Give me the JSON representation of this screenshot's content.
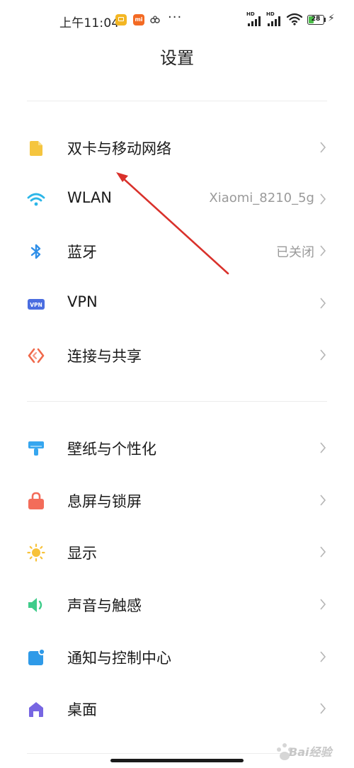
{
  "status_bar": {
    "time": "上午11:04",
    "battery": "28",
    "icons": [
      "note-icon",
      "mi-icon",
      "link-icon",
      "more-icon",
      "signal-icon",
      "signal-icon",
      "wifi-icon",
      "battery-icon",
      "charging-icon"
    ]
  },
  "header": {
    "title": "设置"
  },
  "sections": [
    {
      "items": [
        {
          "label": "双卡与移动网络",
          "value": "",
          "icon": "sim-card-icon",
          "color": "#f5c53f"
        },
        {
          "label": "WLAN",
          "value": "Xiaomi_8210_5g",
          "icon": "wifi-icon",
          "color": "#2cb6e8"
        },
        {
          "label": "蓝牙",
          "value": "已关闭",
          "icon": "bluetooth-icon",
          "color": "#2f8fe8"
        },
        {
          "label": "VPN",
          "value": "",
          "icon": "vpn-icon",
          "color": "#4a6de0"
        },
        {
          "label": "连接与共享",
          "value": "",
          "icon": "connection-share-icon",
          "color": "#f0694b"
        }
      ]
    },
    {
      "items": [
        {
          "label": "壁纸与个性化",
          "value": "",
          "icon": "wallpaper-icon",
          "color": "#36a6ef"
        },
        {
          "label": "息屏与锁屏",
          "value": "",
          "icon": "lock-icon",
          "color": "#f36c5a"
        },
        {
          "label": "显示",
          "value": "",
          "icon": "brightness-icon",
          "color": "#f7c23a"
        },
        {
          "label": "声音与触感",
          "value": "",
          "icon": "sound-icon",
          "color": "#3fcc8a"
        },
        {
          "label": "通知与控制中心",
          "value": "",
          "icon": "notification-icon",
          "color": "#2f9ae8"
        },
        {
          "label": "桌面",
          "value": "",
          "icon": "home-icon",
          "color": "#7766e2"
        }
      ]
    }
  ],
  "annotation": {
    "arrow_color": "#d9312b"
  },
  "watermark": {
    "text": "Bai经验"
  }
}
